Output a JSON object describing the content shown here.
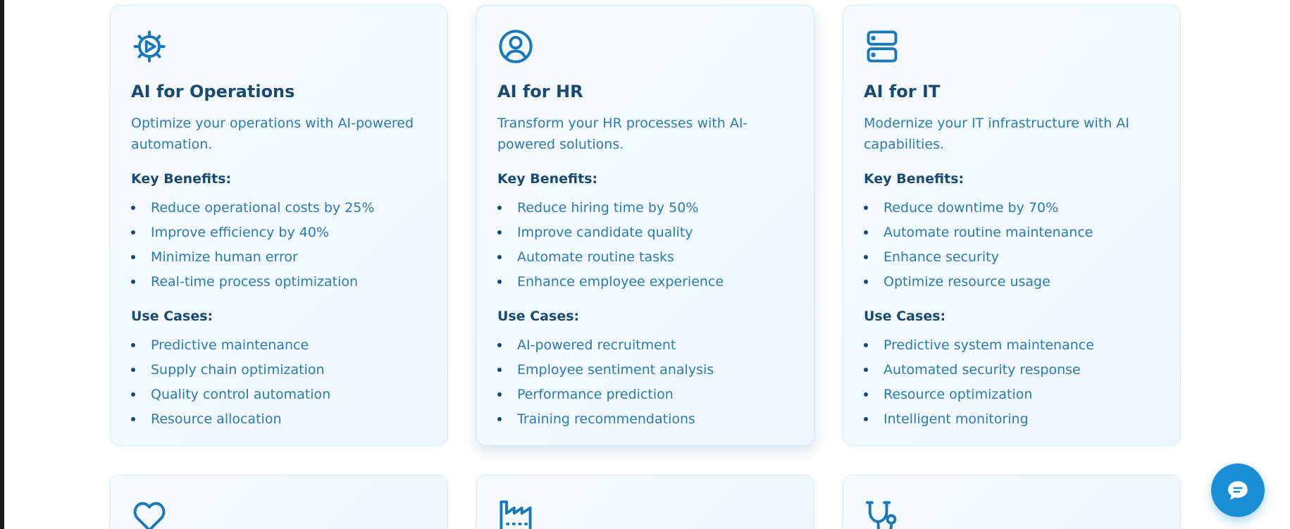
{
  "colors": {
    "accent": "#1a8fd8",
    "icon": "#1a78b8",
    "title": "#1b4a70",
    "body_text": "#2b7bb0",
    "card_border": "#d6eaf7",
    "card_background": "#f2f9fe"
  },
  "cards": [
    {
      "icon": "gear-play-icon",
      "title": "AI for Operations",
      "description": "Optimize your operations with AI-powered automation.",
      "benefits_heading": "Key Benefits:",
      "benefits": [
        "Reduce operational costs by 25%",
        "Improve efficiency by 40%",
        "Minimize human error",
        "Real-time process optimization"
      ],
      "use_cases_heading": "Use Cases:",
      "use_cases": [
        "Predictive maintenance",
        "Supply chain optimization",
        "Quality control automation",
        "Resource allocation"
      ]
    },
    {
      "icon": "user-circle-icon",
      "title": "AI for HR",
      "description": "Transform your HR processes with AI-powered solutions.",
      "benefits_heading": "Key Benefits:",
      "benefits": [
        "Reduce hiring time by 50%",
        "Improve candidate quality",
        "Automate routine tasks",
        "Enhance employee experience"
      ],
      "use_cases_heading": "Use Cases:",
      "use_cases": [
        "AI-powered recruitment",
        "Employee sentiment analysis",
        "Performance prediction",
        "Training recommendations"
      ]
    },
    {
      "icon": "server-icon",
      "title": "AI for IT",
      "description": "Modernize your IT infrastructure with AI capabilities.",
      "benefits_heading": "Key Benefits:",
      "benefits": [
        "Reduce downtime by 70%",
        "Automate routine maintenance",
        "Enhance security",
        "Optimize resource usage"
      ],
      "use_cases_heading": "Use Cases:",
      "use_cases": [
        "Predictive system maintenance",
        "Automated security response",
        "Resource optimization",
        "Intelligent monitoring"
      ]
    }
  ],
  "partial_cards": [
    {
      "icon": "heart-icon"
    },
    {
      "icon": "factory-icon"
    },
    {
      "icon": "stethoscope-icon"
    }
  ],
  "chat_button": {
    "icon": "chat-bubble-icon"
  }
}
